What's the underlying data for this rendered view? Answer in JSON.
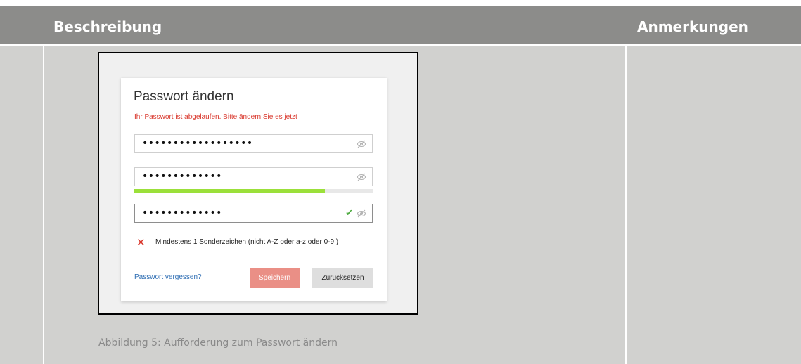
{
  "table": {
    "headers": {
      "description": "Beschreibung",
      "notes": "Anmerkungen"
    }
  },
  "dialog": {
    "title": "Passwort ändern",
    "error_message": "Ihr Passwort ist abgelaufen. Bitte ändern Sie es jetzt",
    "fields": {
      "current_password_mask": "••••••••••••••••••",
      "new_password_mask": "•••••••••••••",
      "confirm_password_mask": "•••••••••••••"
    },
    "strength_level_percent": 80,
    "rule_text": "Mindestens 1 Sonderzeichen (nicht A-Z oder a-z oder 0-9 )",
    "forgot_link": "Passwort vergessen?",
    "save_label": "Speichern",
    "reset_label": "Zurücksetzen",
    "icons": {
      "eye": "eye-slash-icon",
      "check": "check-icon",
      "rule_fail": "cross-icon"
    },
    "colors": {
      "error": "#d9362b",
      "link": "#2d6db3",
      "save_button": "#ea8f86",
      "strength_bar": "#9be03a",
      "check": "#4caa3e"
    }
  },
  "caption": "Abbildung 5: Aufforderung zum Passwort ändern"
}
